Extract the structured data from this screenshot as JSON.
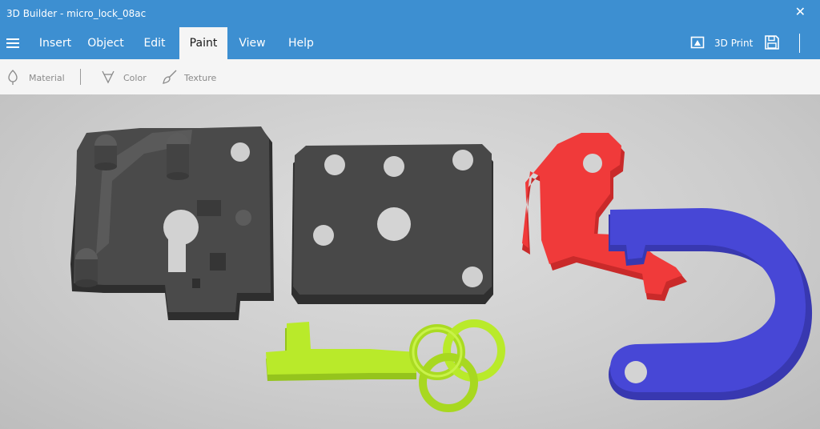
{
  "window": {
    "title": "3D Builder - micro_lock_08ac",
    "close_glyph": "✕"
  },
  "menu": {
    "items": [
      {
        "id": "insert",
        "label": "Insert"
      },
      {
        "id": "object",
        "label": "Object"
      },
      {
        "id": "edit",
        "label": "Edit"
      },
      {
        "id": "paint",
        "label": "Paint",
        "active": true
      },
      {
        "id": "view",
        "label": "View"
      },
      {
        "id": "help",
        "label": "Help"
      }
    ],
    "print_label": "3D Print"
  },
  "toolbar": {
    "material_label": "Material",
    "color_label": "Color",
    "texture_label": "Texture"
  },
  "colors": {
    "accent": "#3d8fd1",
    "toolbar_bg": "#f5f5f5",
    "part_gray": "#3f3f3f",
    "part_red": "#f03a3a",
    "part_blue": "#4747d6",
    "part_green": "#b9ea2a"
  },
  "scene": {
    "objects": [
      {
        "id": "lock-body",
        "color_name": "dark gray"
      },
      {
        "id": "lock-plate",
        "color_name": "dark gray"
      },
      {
        "id": "latch",
        "color_name": "red"
      },
      {
        "id": "shackle",
        "color_name": "blue"
      },
      {
        "id": "key",
        "color_name": "lime green"
      }
    ]
  }
}
